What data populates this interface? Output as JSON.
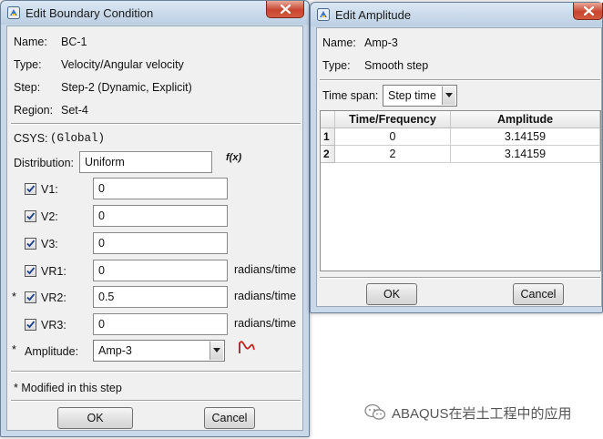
{
  "bc_dialog": {
    "title": "Edit Boundary Condition",
    "name_label": "Name:",
    "name_value": "BC-1",
    "type_label": "Type:",
    "type_value": "Velocity/Angular velocity",
    "step_label": "Step:",
    "step_value": "Step-2 (Dynamic, Explicit)",
    "region_label": "Region:",
    "region_value": "Set-4",
    "csys_label": "CSYS:",
    "csys_value": "(Global)",
    "distribution_label": "Distribution:",
    "distribution_value": "Uniform",
    "fx_label": "f(x)",
    "components": [
      {
        "marker": "",
        "label": "V1:",
        "value": "0",
        "unit": ""
      },
      {
        "marker": "",
        "label": "V2:",
        "value": "0",
        "unit": ""
      },
      {
        "marker": "",
        "label": "V3:",
        "value": "0",
        "unit": ""
      },
      {
        "marker": "",
        "label": "VR1:",
        "value": "0",
        "unit": "radians/time"
      },
      {
        "marker": "*",
        "label": "VR2:",
        "value": "0.5",
        "unit": "radians/time"
      },
      {
        "marker": "",
        "label": "VR3:",
        "value": "0",
        "unit": "radians/time"
      }
    ],
    "amplitude_marker": "*",
    "amplitude_label": "Amplitude:",
    "amplitude_value": "Amp-3",
    "modified_note": "* Modified in this step",
    "ok_label": "OK",
    "cancel_label": "Cancel"
  },
  "amp_dialog": {
    "title": "Edit Amplitude",
    "name_label": "Name:",
    "name_value": "Amp-3",
    "type_label": "Type:",
    "type_value": "Smooth step",
    "time_span_label": "Time span:",
    "time_span_value": "Step time",
    "table": {
      "headers": [
        "Time/Frequency",
        "Amplitude"
      ],
      "rows": [
        {
          "index": "1",
          "time": "0",
          "amplitude": "3.14159"
        },
        {
          "index": "2",
          "time": "2",
          "amplitude": "3.14159"
        }
      ]
    },
    "ok_label": "OK",
    "cancel_label": "Cancel"
  },
  "watermark": {
    "text": "ABAQUS在岩土工程中的应用",
    "icon": "wechat-icon"
  },
  "colors": {
    "title_bar": "#c9d9ea",
    "close_button": "#c8452f",
    "dialog_body": "#f0f0f0"
  }
}
